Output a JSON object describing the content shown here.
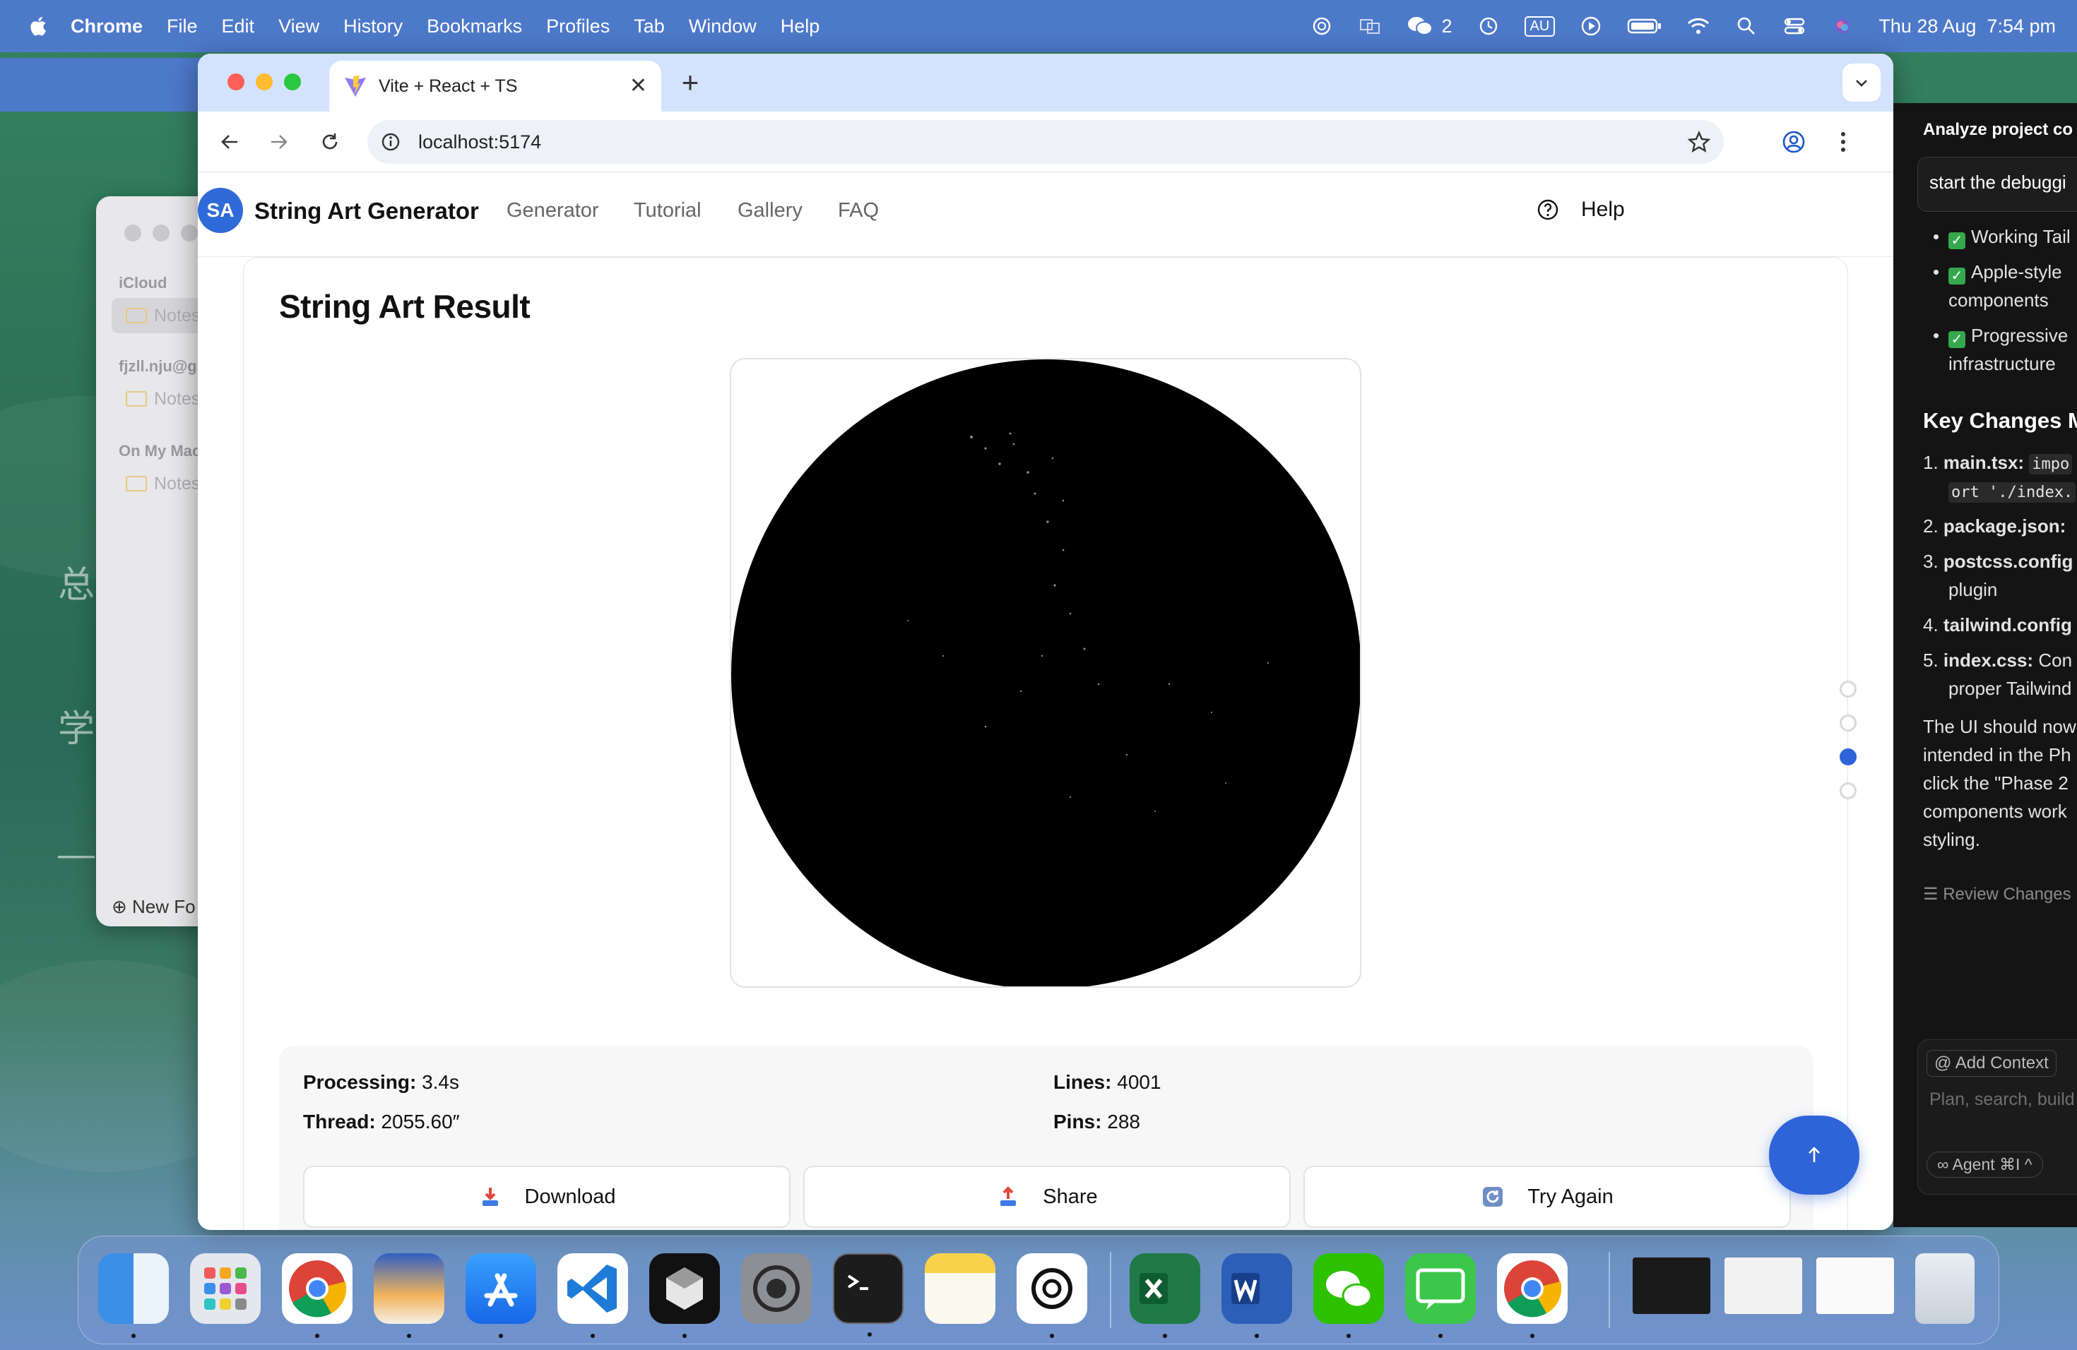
{
  "menubar": {
    "app_name": "Chrome",
    "menus": [
      "File",
      "Edit",
      "View",
      "History",
      "Bookmarks",
      "Profiles",
      "Tab",
      "Window",
      "Help"
    ],
    "wechat_count": "2",
    "input_source": "AU",
    "datetime": "Thu 28 Aug  7:54 pm"
  },
  "notes_window": {
    "groups": [
      "iCloud",
      "fjzll.nju@g",
      "On My Mac"
    ],
    "folder_label": "Notes",
    "new_folder": "New Fo"
  },
  "desktop_glyphs": [
    "总",
    "学",
    "—"
  ],
  "browser": {
    "tab_title": "Vite + React + TS",
    "url": "localhost:5174"
  },
  "app": {
    "logo": "SA",
    "brand": "String Art Generator",
    "nav": [
      "Generator",
      "Tutorial",
      "Gallery",
      "FAQ"
    ],
    "help": "Help",
    "result_title": "String Art Result",
    "stats": {
      "processing_label": "Processing:",
      "processing_value": "3.4s",
      "thread_label": "Thread:",
      "thread_value": "2055.60″",
      "lines_label": "Lines:",
      "lines_value": "4001",
      "pins_label": "Pins:",
      "pins_value": "288"
    },
    "actions": [
      "Download",
      "Share",
      "Try Again"
    ],
    "pager_active_index": 2
  },
  "cursor_panel": {
    "title": "Analyze project co",
    "input": "start the debuggi",
    "checklist": [
      "Working Tail",
      "Apple-style",
      "components",
      "Progressive",
      "infrastructure"
    ],
    "heading": "Key Changes M",
    "items": [
      {
        "n": "1.",
        "name": "main.tsx:",
        "code": "impo",
        "cont": "ort './index."
      },
      {
        "n": "2.",
        "name": "package.json:"
      },
      {
        "n": "3.",
        "name": "postcss.config",
        "cont": "plugin"
      },
      {
        "n": "4.",
        "name": "tailwind.config"
      },
      {
        "n": "5.",
        "name": "index.css:",
        "rest": "Con",
        "cont": "proper Tailwind"
      }
    ],
    "paragraph": [
      "The UI should now",
      "intended in the Ph",
      "click the \"Phase 2",
      "components work",
      "styling."
    ],
    "review": "Review Changes",
    "add_context": "@ Add Context",
    "placeholder": "Plan, search, build",
    "agent": "∞ Agent ⌘I ^"
  },
  "colors": {
    "menubar": "#4d79c9",
    "accent_blue": "#2f63d8",
    "tabstrip": "#d3e3fd"
  }
}
